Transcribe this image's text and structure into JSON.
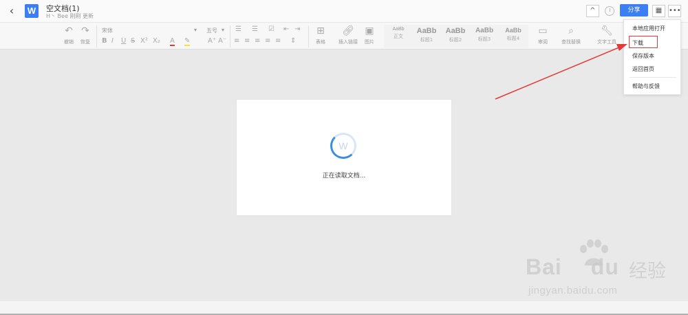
{
  "header": {
    "doc_title": "空文档(1)",
    "doc_subtitle": "H丶 Bee 刚刚 更新",
    "logo_letter": "W",
    "share_label": "分享",
    "collapse_label": "^",
    "more_label": "•••"
  },
  "toolbar": {
    "undo": "撤销",
    "redo": "恢复",
    "font_name": "宋体",
    "font_size": "五号",
    "format": {
      "bold": "B",
      "italic": "I",
      "underline": "U",
      "strike": "S",
      "super": "X²",
      "sub": "X₂"
    },
    "color_a": "A",
    "table": "表格",
    "insert_link": "插入链接",
    "image": "图片",
    "styles": [
      {
        "name": "AaBb",
        "label": "正文"
      },
      {
        "name": "AaBb",
        "label": "标题1"
      },
      {
        "name": "AaBb",
        "label": "标题2"
      },
      {
        "name": "AaBb",
        "label": "标题3"
      },
      {
        "name": "AaBb",
        "label": "标题4"
      }
    ],
    "review": "审阅",
    "find_replace": "查找替换",
    "text_tools": "文字工具"
  },
  "document": {
    "loading_text": "正在读取文档...",
    "spinner_letter": "W"
  },
  "menu": {
    "items": [
      "本地应用打开",
      "下载",
      "保存版本",
      "返回首页",
      "帮助与反馈"
    ]
  },
  "watermark": {
    "baidu": "Bai",
    "du": "du",
    "jingyan": "经验",
    "url": "jingyan.baidu.com"
  },
  "colors": {
    "accent": "#3b7ff2",
    "highlight": "#e53935"
  }
}
